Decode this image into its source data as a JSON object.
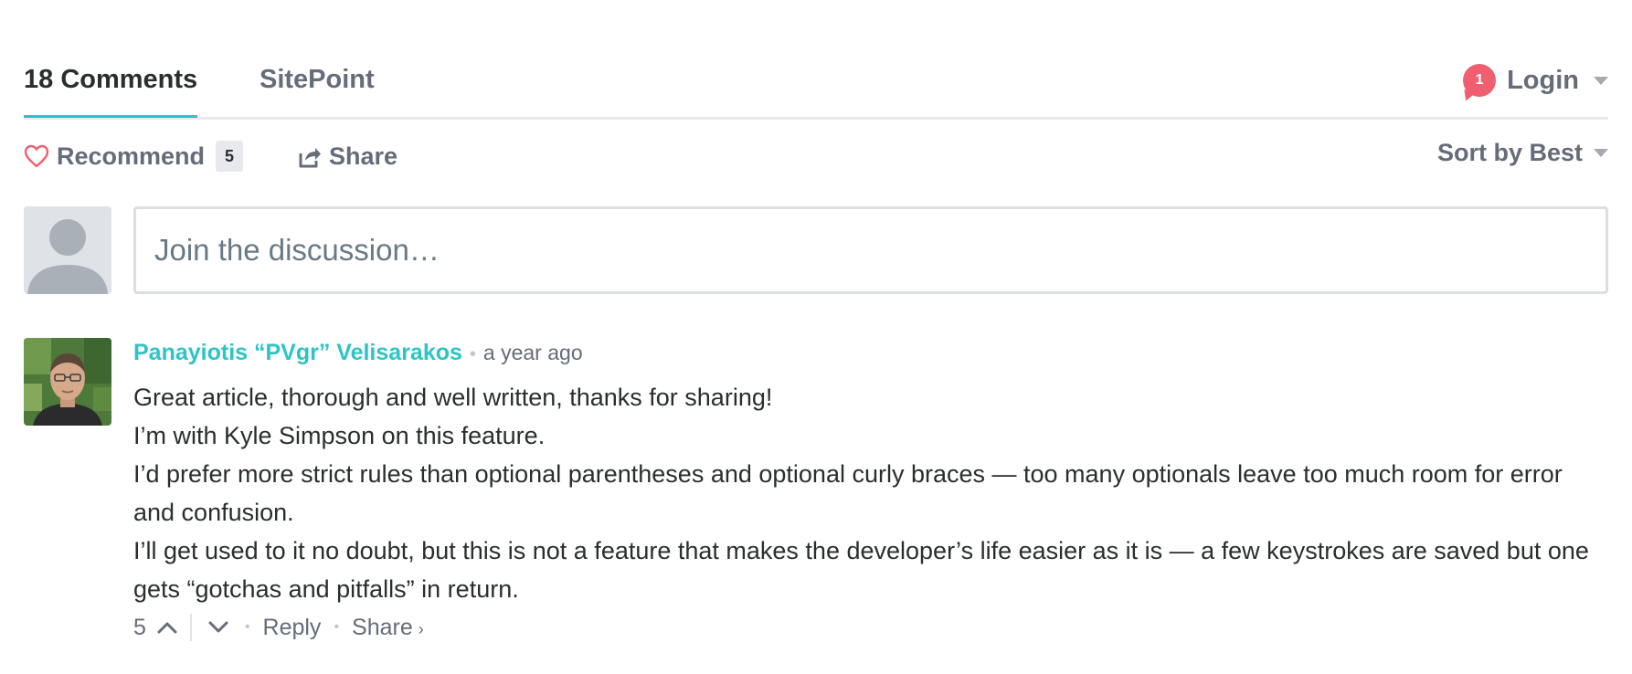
{
  "nav": {
    "tabs": [
      {
        "label": "18 Comments"
      },
      {
        "label": "SitePoint"
      }
    ],
    "notification_count": "1",
    "login_label": "Login"
  },
  "toolbar": {
    "recommend_label": "Recommend",
    "recommend_count": "5",
    "share_label": "Share",
    "sort_label": "Sort by Best"
  },
  "composer": {
    "placeholder": "Join the discussion…"
  },
  "comment": {
    "author": "Panayiotis “PVgr” Velisarakos",
    "time": "a year ago",
    "paragraphs": [
      "Great article, thorough and well written, thanks for sharing!",
      "I’m with Kyle Simpson on this feature.",
      "I’d prefer more strict rules than optional parentheses and optional curly braces — too many optionals leave too much room for error and confusion.",
      "I’ll get used to it no doubt, but this is not a feature that makes the developer’s life easier as it is — a few keystrokes are saved but one gets “gotchas and pitfalls” in return."
    ],
    "votes": "5",
    "reply_label": "Reply",
    "share_label": "Share",
    "share_chevron": "›"
  },
  "colors": {
    "accent": "#2ec4c6",
    "notification": "#f05f70",
    "heart": "#f05f70",
    "text_muted": "#656c7a",
    "text_main": "#2a2e2e"
  },
  "icons": {
    "heart": "heart-icon",
    "share": "share-icon",
    "upvote": "chevron-up-icon",
    "downvote": "chevron-down-icon",
    "caret": "caret-down-icon",
    "avatar_placeholder": "user-silhouette-icon"
  }
}
